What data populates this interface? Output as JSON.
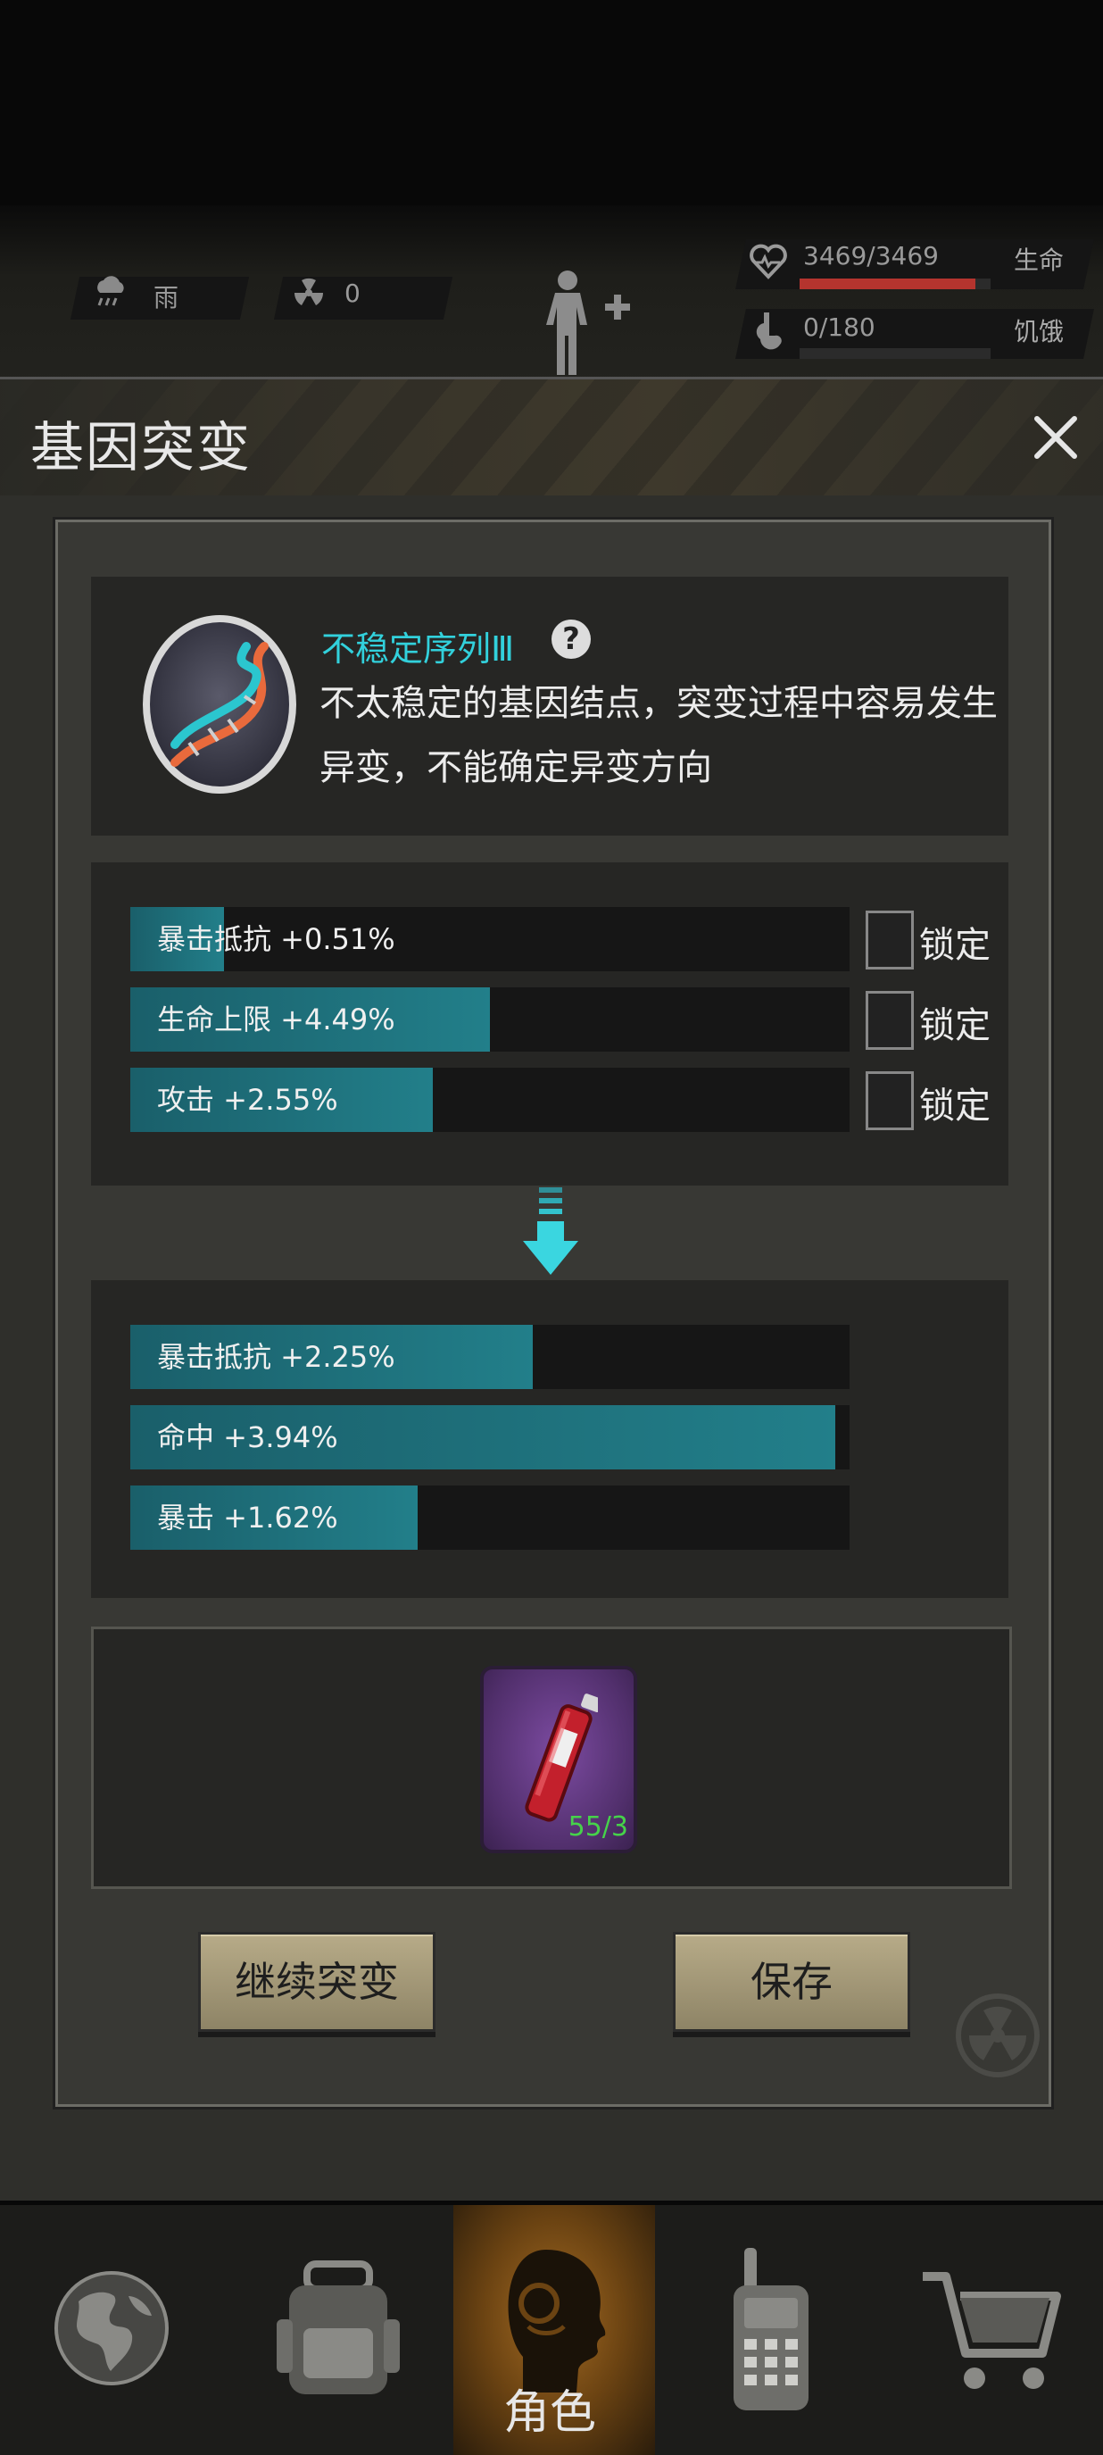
{
  "status": {
    "weather_label": "雨",
    "radiation_value": "0",
    "hp_value": "3469/3469",
    "hp_label": "生命",
    "hp_fraction": 0.92,
    "hunger_value": "0/180",
    "hunger_label": "饥饿",
    "hunger_fraction": 0.0
  },
  "dialog": {
    "title": "基因突变",
    "gene": {
      "name": "不稳定序列Ⅲ",
      "desc_line1": "不太稳定的基因结点，突变过程中容易发生",
      "desc_line2": "异变，不能确定异变方向"
    },
    "current_stats": [
      {
        "label": "暴击抵抗 +0.51%",
        "fraction": 0.13,
        "lock_label": "锁定",
        "locked": false
      },
      {
        "label": "生命上限 +4.49%",
        "fraction": 0.5,
        "lock_label": "锁定",
        "locked": false
      },
      {
        "label": "攻击 +2.55%",
        "fraction": 0.42,
        "lock_label": "锁定",
        "locked": false
      }
    ],
    "new_stats": [
      {
        "label": "暴击抵抗 +2.25%",
        "fraction": 0.56
      },
      {
        "label": "命中 +3.94%",
        "fraction": 0.98
      },
      {
        "label": "暴击 +1.62%",
        "fraction": 0.4
      }
    ],
    "item_count": "55/3",
    "continue_label": "继续突变",
    "save_label": "保存"
  },
  "nav": {
    "active_label": "角色"
  },
  "colors": {
    "accent_cyan": "#32d1dc",
    "bar_fill": "#227f8a",
    "hp_red": "#b5342e",
    "button_tan": "#b7ab88",
    "active_tab_orange": "#a46b23"
  }
}
